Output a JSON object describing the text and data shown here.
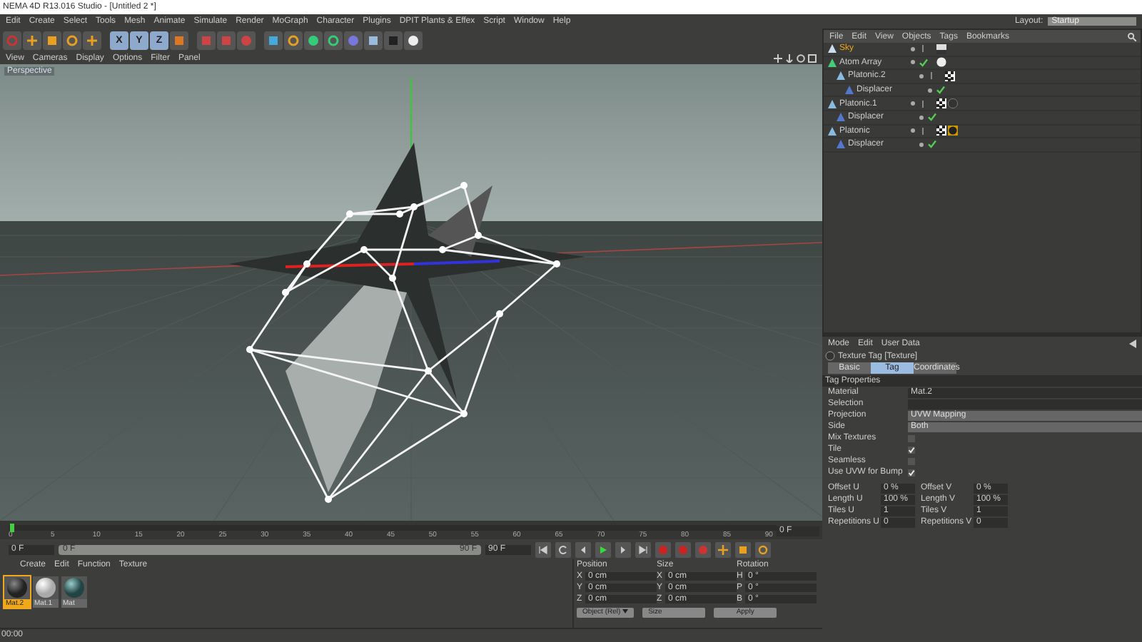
{
  "window": {
    "title": "NEMA 4D R13.016 Studio - [Untitled 2 *]"
  },
  "menu_bar": [
    "Edit",
    "Create",
    "Select",
    "Tools",
    "Mesh",
    "Animate",
    "Simulate",
    "Render",
    "MoGraph",
    "Character",
    "Plugins",
    "DPIT Plants & Effex",
    "Script",
    "Window",
    "Help"
  ],
  "layout": {
    "label": "Layout:",
    "value": "Startup"
  },
  "toolbar": {
    "axes": [
      "X",
      "Y",
      "Z"
    ]
  },
  "viewport": {
    "menu": [
      "View",
      "Cameras",
      "Display",
      "Options",
      "Filter",
      "Panel"
    ],
    "camera_label": "Perspective"
  },
  "object_manager": {
    "menu": [
      "File",
      "Edit",
      "View",
      "Objects",
      "Tags",
      "Bookmarks"
    ],
    "objects": [
      {
        "name": "Sky",
        "selected": true,
        "checked": false,
        "tags": [
          {
            "kind": "sky"
          }
        ]
      },
      {
        "name": "Atom Array",
        "selected": false,
        "checked": true,
        "tags": [
          {
            "kind": "white-material"
          }
        ],
        "children": [
          {
            "name": "Platonic.2",
            "selected": false,
            "checked": false,
            "tags": [
              {
                "kind": "texture"
              }
            ],
            "children": [
              {
                "name": "Displacer",
                "selected": false,
                "checked": true
              }
            ]
          }
        ]
      },
      {
        "name": "Platonic.1",
        "selected": false,
        "checked": false,
        "tags": [
          {
            "kind": "texture"
          },
          {
            "kind": "dark-material"
          }
        ],
        "children": [
          {
            "name": "Displacer",
            "selected": false,
            "checked": true
          }
        ]
      },
      {
        "name": "Platonic",
        "selected": false,
        "checked": false,
        "tags": [
          {
            "kind": "texture"
          },
          {
            "kind": "selected-material"
          }
        ],
        "children": [
          {
            "name": "Displacer",
            "selected": false,
            "checked": true
          }
        ]
      }
    ]
  },
  "attributes": {
    "menu": [
      "Mode",
      "Edit",
      "User Data"
    ],
    "title": "Texture Tag [Texture]",
    "tabs": [
      {
        "label": "Basic",
        "selected": false
      },
      {
        "label": "Tag",
        "selected": true
      },
      {
        "label": "Coordinates",
        "selected": false
      }
    ],
    "section": "Tag Properties",
    "fields": [
      {
        "kind": "link",
        "label": "Material",
        "value": "Mat.2"
      },
      {
        "kind": "text",
        "label": "Selection"
      },
      {
        "kind": "dropdown",
        "label": "Projection",
        "value": "UVW Mapping"
      },
      {
        "kind": "dropdown",
        "label": "Side",
        "value": "Both"
      },
      {
        "kind": "checkbox",
        "label": "Mix Textures",
        "checked": false
      },
      {
        "kind": "checkbox",
        "label": "Tile",
        "checked": true
      },
      {
        "kind": "checkbox",
        "label": "Seamless",
        "checked": false
      },
      {
        "kind": "checkbox",
        "label": "Use UVW for Bump",
        "checked": true
      }
    ],
    "pairs": [
      [
        {
          "label": "Offset U",
          "value": "0 %"
        },
        {
          "label": "Offset V",
          "value": "0 %"
        }
      ],
      [
        {
          "label": "Length U",
          "value": "100 %"
        },
        {
          "label": "Length V",
          "value": "100 %"
        }
      ],
      [
        {
          "label": "Tiles U",
          "value": "1"
        },
        {
          "label": "Tiles V",
          "value": "1"
        }
      ],
      [
        {
          "label": "Repetitions U",
          "value": "0"
        },
        {
          "label": "Repetitions V",
          "value": "0"
        }
      ]
    ]
  },
  "timeline": {
    "ticks": [
      "0",
      "5",
      "10",
      "15",
      "20",
      "25",
      "30",
      "35",
      "40",
      "45",
      "50",
      "55",
      "60",
      "65",
      "70",
      "75",
      "80",
      "85",
      "90"
    ],
    "current_frame": "0 F",
    "start": "0 F",
    "range": {
      "start": "0 F",
      "end": "90 F",
      "level": 1
    },
    "end": "90 F"
  },
  "materials": {
    "menu": [
      "Create",
      "Edit",
      "Function",
      "Texture"
    ],
    "items": [
      {
        "name": "Mat.2",
        "kind": "dark",
        "selected": true
      },
      {
        "name": "Mat.1",
        "kind": "white",
        "selected": false
      },
      {
        "name": "Mat",
        "kind": "teal",
        "selected": false
      }
    ]
  },
  "coordinates": {
    "headers": [
      "Position",
      "Size",
      "Rotation"
    ],
    "rows": [
      {
        "axis": "X",
        "position": "0 cm",
        "size_axis": "X",
        "size": "0 cm",
        "rot_axis": "H",
        "rotation": "0 °"
      },
      {
        "axis": "Y",
        "position": "0 cm",
        "size_axis": "Y",
        "size": "0 cm",
        "rot_axis": "P",
        "rotation": "0 °"
      },
      {
        "axis": "Z",
        "position": "0 cm",
        "size_axis": "Z",
        "size": "0 cm",
        "rot_axis": "B",
        "rotation": "0 °"
      }
    ],
    "mode": "Object (Rel)",
    "size_mode": "Size",
    "apply": "Apply"
  },
  "status_bar": {
    "time": "00:00"
  }
}
